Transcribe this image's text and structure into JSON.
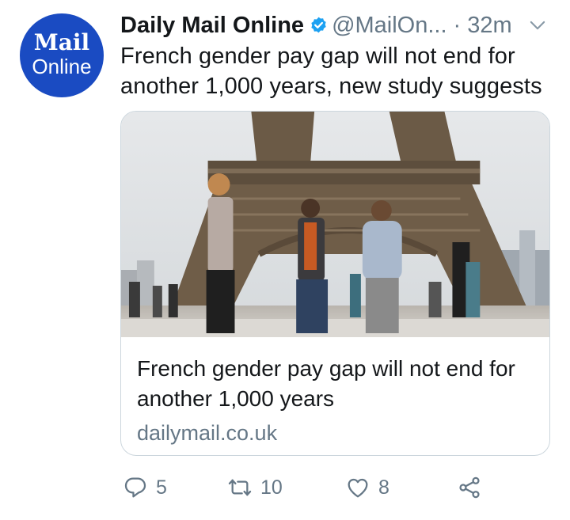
{
  "tweet": {
    "avatar": {
      "line1": "Mail",
      "line2": "Online"
    },
    "author": "Daily Mail Online",
    "handle": "@MailOn...",
    "time": "· 32m",
    "text": "French gender pay gap will not end for another 1,000 years, new study suggests"
  },
  "card": {
    "title": "French gender pay gap will not end for another 1,000 years",
    "domain": "dailymail.co.uk"
  },
  "actions": {
    "reply_count": "5",
    "retweet_count": "10",
    "like_count": "8"
  },
  "colors": {
    "avatar_bg": "#1a4bc2",
    "verified": "#1da1f2",
    "muted": "#657786",
    "text": "#14171a"
  }
}
